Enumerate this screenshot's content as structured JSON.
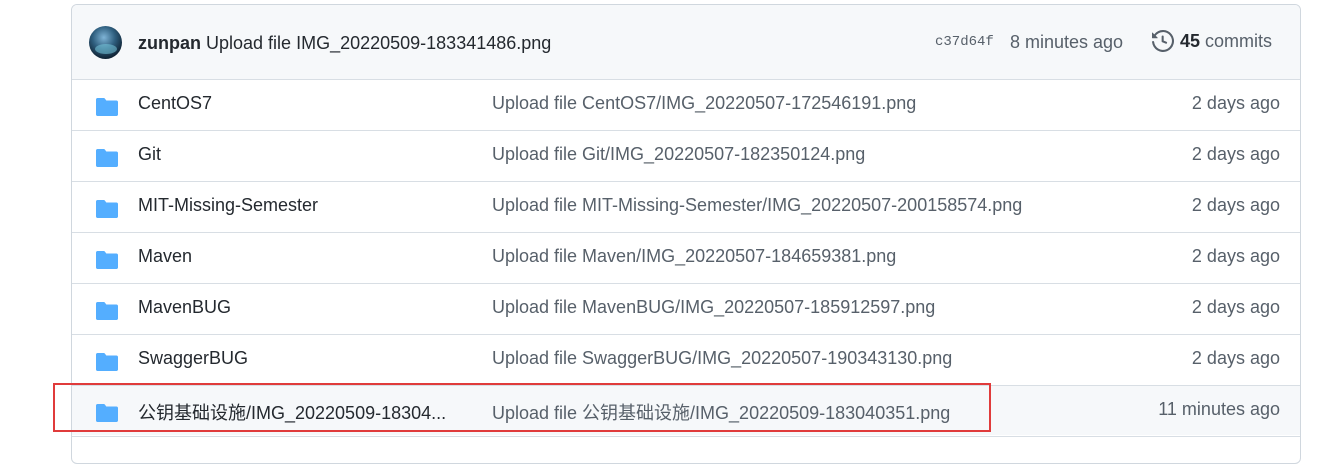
{
  "latest_commit": {
    "author": "zunpan",
    "message": "Upload file IMG_20220509-183341486.png",
    "sha": "c37d64f",
    "time": "8 minutes ago",
    "commits_count": "45",
    "commits_label": "commits"
  },
  "files": [
    {
      "name": "CentOS7",
      "message": "Upload file CentOS7/IMG_20220507-172546191.png",
      "time": "2 days ago"
    },
    {
      "name": "Git",
      "message": "Upload file Git/IMG_20220507-182350124.png",
      "time": "2 days ago"
    },
    {
      "name": "MIT-Missing-Semester",
      "message": "Upload file MIT-Missing-Semester/IMG_20220507-200158574.png",
      "time": "2 days ago"
    },
    {
      "name": "Maven",
      "message": "Upload file Maven/IMG_20220507-184659381.png",
      "time": "2 days ago"
    },
    {
      "name": "MavenBUG",
      "message": "Upload file MavenBUG/IMG_20220507-185912597.png",
      "time": "2 days ago"
    },
    {
      "name": "SwaggerBUG",
      "message": "Upload file SwaggerBUG/IMG_20220507-190343130.png",
      "time": "2 days ago"
    },
    {
      "name": "公钥基础设施/IMG_20220509-18304...",
      "message": "Upload file 公钥基础设施/IMG_20220509-183040351.png",
      "time": "11 minutes ago"
    }
  ],
  "colors": {
    "folder": "#54aeff",
    "highlight_border": "#e03b3b"
  }
}
